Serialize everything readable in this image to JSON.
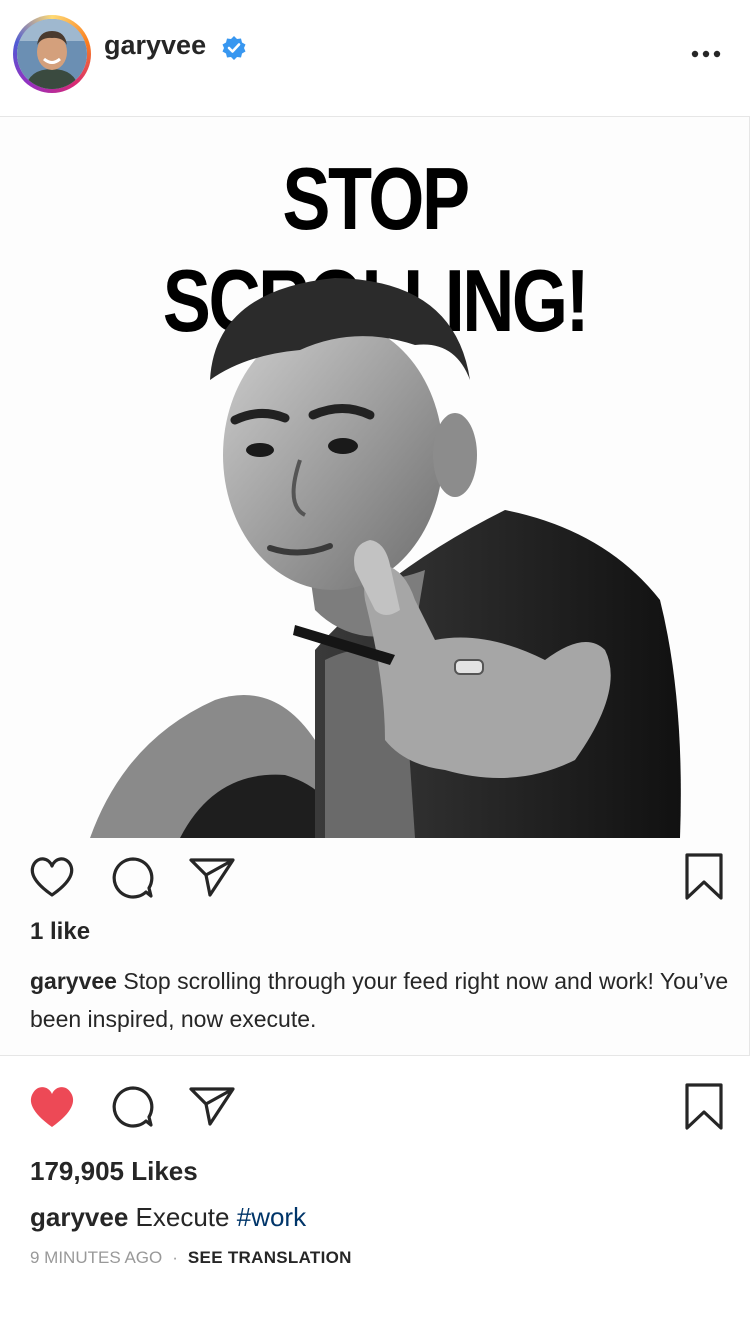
{
  "header": {
    "username": "garyvee",
    "verified": true,
    "more_icon": "more-horizontal-icon"
  },
  "post_image": {
    "headline": "STOP SCROLLING!",
    "inner_username": "garyvee",
    "inner_likes": "1 like",
    "inner_caption": "Stop scrolling through your feed right now and work! You’ve been inspired, now execute.",
    "inner_icons": [
      "heart-outline-icon",
      "comment-icon",
      "share-icon",
      "bookmark-icon"
    ]
  },
  "post": {
    "likes": "179,905 Likes",
    "caption_user": "garyvee",
    "caption_text": "Execute",
    "hashtag": "#work",
    "time": "9 MINUTES AGO",
    "see_translation": "SEE TRANSLATION",
    "icons": [
      "heart-filled-icon",
      "comment-icon",
      "share-icon",
      "bookmark-icon"
    ]
  },
  "colors": {
    "like_red": "#ed4956",
    "hashtag_blue": "#003569",
    "verified_blue": "#3897f0",
    "meta_gray": "#999999"
  }
}
